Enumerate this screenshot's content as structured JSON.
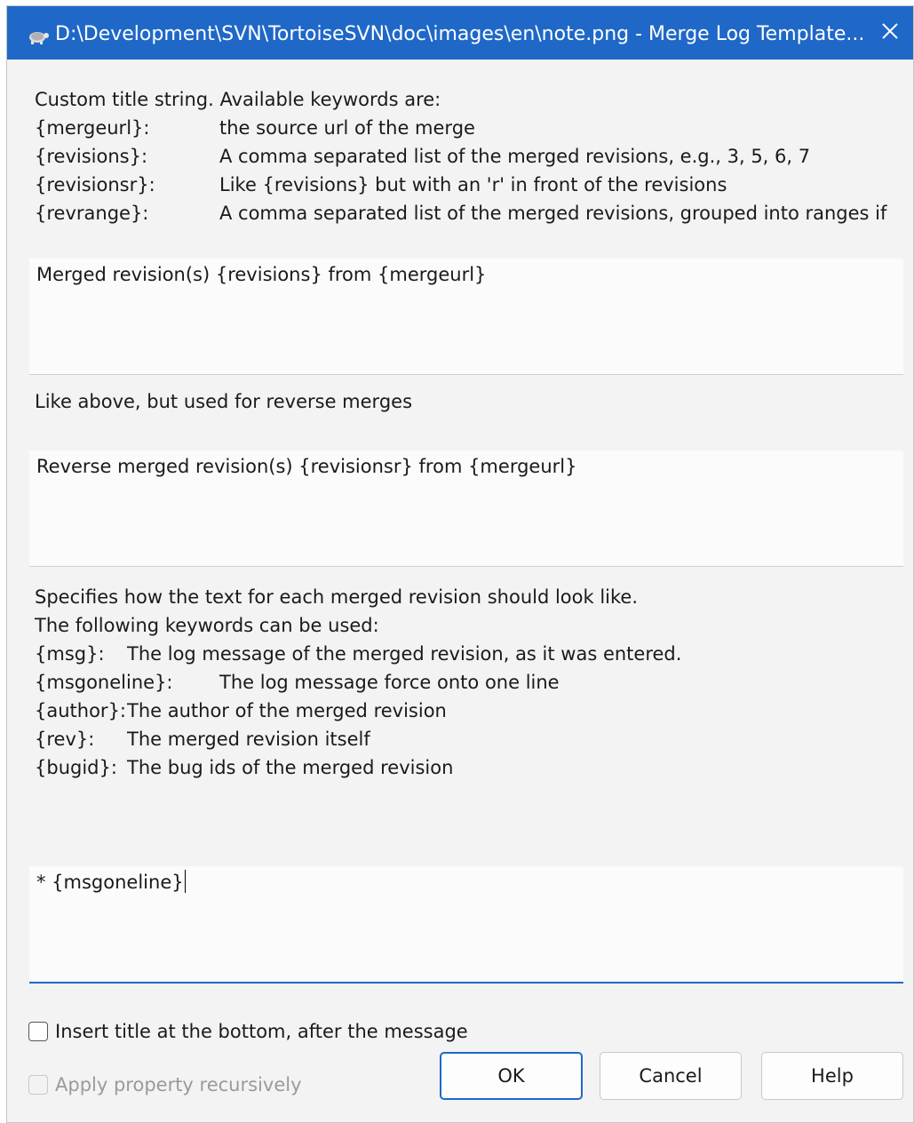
{
  "window": {
    "title": "D:\\Development\\SVN\\TortoiseSVN\\doc\\images\\en\\note.png - Merge Log Template..."
  },
  "title_section": {
    "intro": "Custom title string. Available keywords are:",
    "keywords": [
      {
        "key": "{mergeurl}:",
        "desc": "the source url of the merge"
      },
      {
        "key": "{revisions}:",
        "desc": "A comma separated list of the merged revisions, e.g., 3, 5, 6, 7"
      },
      {
        "key": "{revisionsr}:",
        "desc": "Like {revisions} but with an 'r' in front of the revisions"
      },
      {
        "key": "{revrange}:",
        "desc": "A comma separated list of the merged revisions, grouped into ranges if"
      }
    ],
    "value": "Merged revision(s) {revisions} from {mergeurl}"
  },
  "reverse_section": {
    "label": "Like above, but used for reverse merges",
    "value": "Reverse merged revision(s) {revisionsr} from {mergeurl}"
  },
  "message_section": {
    "lines": [
      "Specifies how the text for each merged revision should look like.",
      "The following keywords can be used:"
    ],
    "keywords": [
      {
        "key": "{msg}:",
        "desc": "The log message of the merged revision, as it was entered."
      },
      {
        "key": "{msgoneline}:",
        "desc": "The log message force onto one line"
      },
      {
        "key": "{author}:",
        "desc": "The author of the merged revision"
      },
      {
        "key": "{rev}:",
        "desc": "The merged revision itself"
      },
      {
        "key": "{bugid}:",
        "desc": "The bug ids of the merged revision"
      }
    ],
    "value": "* {msgoneline}"
  },
  "options": {
    "insert_title_bottom": {
      "label": "Insert title at the bottom, after the message",
      "checked": false
    },
    "apply_recursively": {
      "label": "Apply property recursively",
      "checked": false,
      "enabled": false
    }
  },
  "buttons": {
    "ok": "OK",
    "cancel": "Cancel",
    "help": "Help"
  }
}
